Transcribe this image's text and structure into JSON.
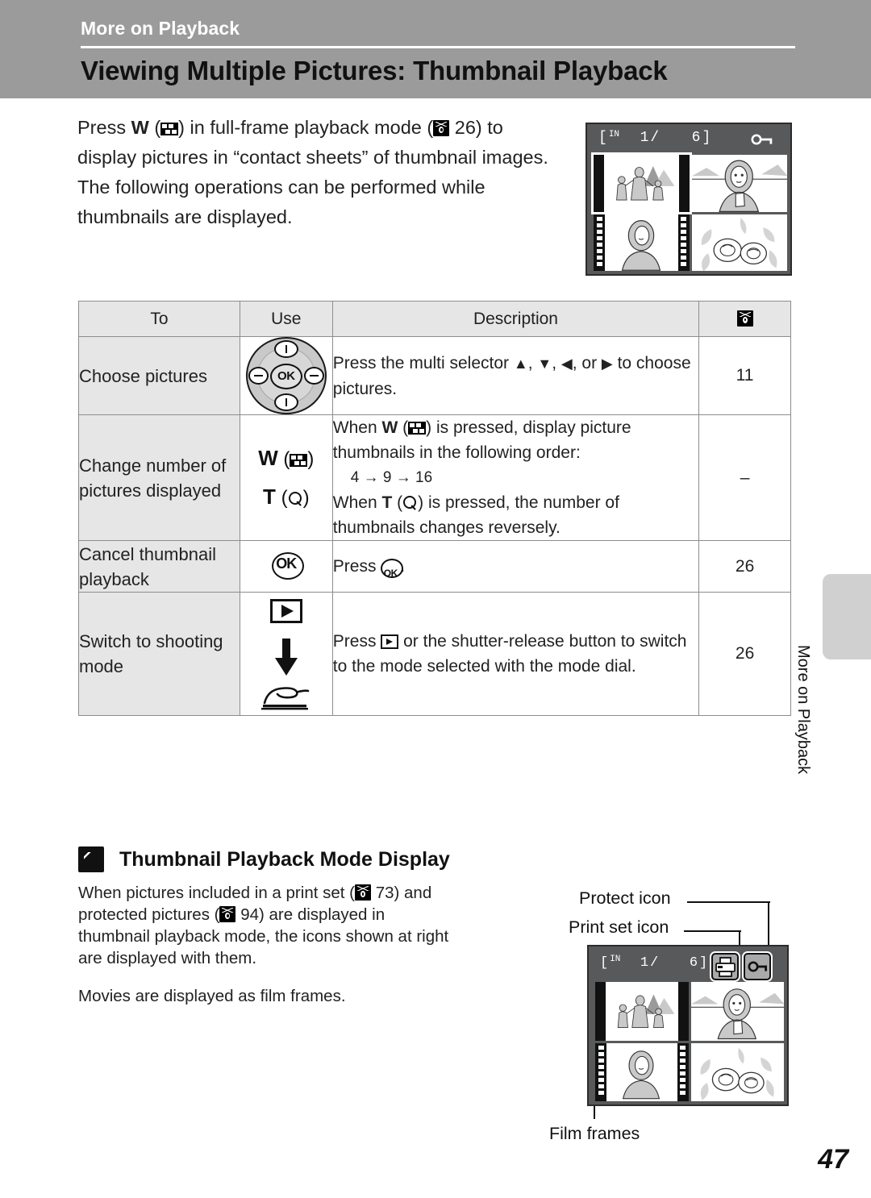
{
  "header": {
    "chapter": "More on Playback",
    "title": "Viewing Multiple Pictures: Thumbnail Playback"
  },
  "intro": {
    "line1_a": "Press ",
    "line1_w": "W",
    "line1_b": " (",
    "line1_c": ") in full-frame playback mode (",
    "line1_page": "26",
    "line1_d": ") to display pictures in “contact sheets” of thumbnail images.",
    "paragraph2": "The following operations can be performed while thumbnails are displayed."
  },
  "top_shot": {
    "in_label": "IN",
    "counter": "1/",
    "total": "6",
    "bracket_open": "[",
    "bracket_close": "]",
    "protect_icon": "key-icon"
  },
  "table": {
    "headers": {
      "to": "To",
      "use": "Use",
      "description": "Description",
      "reference": "page-reference-icon"
    },
    "rows": [
      {
        "to": "Choose pictures",
        "use_icon": "multi-selector-icon",
        "desc_pre": "Press the multi selector ",
        "desc_up": "▲",
        "desc_mid1": ", ",
        "desc_down": "▼",
        "desc_mid2": ", ",
        "desc_left": "◀",
        "desc_mid3": ", or ",
        "desc_right": "▶",
        "desc_post": " to choose pictures.",
        "ref": "11"
      },
      {
        "to": "Change number of pictures displayed",
        "use_w": "W",
        "use_w_icon": "thumbnail-icon",
        "use_t": "T",
        "use_t_icon": "magnify-icon",
        "desc_l1a": "When ",
        "desc_l1b": "W",
        "desc_l1c": " (",
        "desc_l1d": ") is pressed, display picture thumbnails in the following order:",
        "desc_order": "4 → 9 → 16",
        "desc_l3a": "When ",
        "desc_l3b": "T",
        "desc_l3c": " (",
        "desc_l3d": ") is pressed, the number of thumbnails changes reversely.",
        "ref": "–"
      },
      {
        "to": "Cancel thumbnail playback",
        "use_icon": "ok-button-icon",
        "desc_pre": "Press ",
        "desc_icon": "ok-button-icon",
        "desc_post": ".",
        "ref": "26"
      },
      {
        "to": "Switch to shooting mode",
        "use_icon1": "playback-button-icon",
        "use_icon2": "down-arrow-icon",
        "use_icon3": "shutter-release-icon",
        "desc_pre": "Press ",
        "desc_icon": "playback-button-icon",
        "desc_post": " or the shutter-release button to switch to the mode selected with the mode dial.",
        "ref": "26"
      }
    ]
  },
  "side_tab": {
    "label": "More on Playback"
  },
  "note": {
    "icon": "pencil-note-icon",
    "title": "Thumbnail Playback Mode Display",
    "body_a": "When pictures included in a print set (",
    "body_page1": "73",
    "body_b": ") and protected pictures (",
    "body_page2": "94",
    "body_c": ") are displayed in thumbnail playback mode, the icons shown at right are displayed with them.",
    "body_d": "Movies are displayed as film frames."
  },
  "bottom_shot": {
    "callout_protect": "Protect icon",
    "callout_print": "Print set icon",
    "callout_film": "Film frames",
    "in_label": "IN",
    "counter": "1/",
    "total": "6",
    "bracket_open": "[",
    "bracket_close": "]",
    "print_icon": "printer-icon",
    "protect_icon": "key-icon"
  },
  "page_number": "47",
  "colors": {
    "header_band": "#9b9b9b",
    "screen_bg": "#58595b",
    "table_head": "#e6e6e6",
    "table_to_cell": "#e6e6e6",
    "rule": "#8d8d8d",
    "tab": "#d0d0d0"
  }
}
